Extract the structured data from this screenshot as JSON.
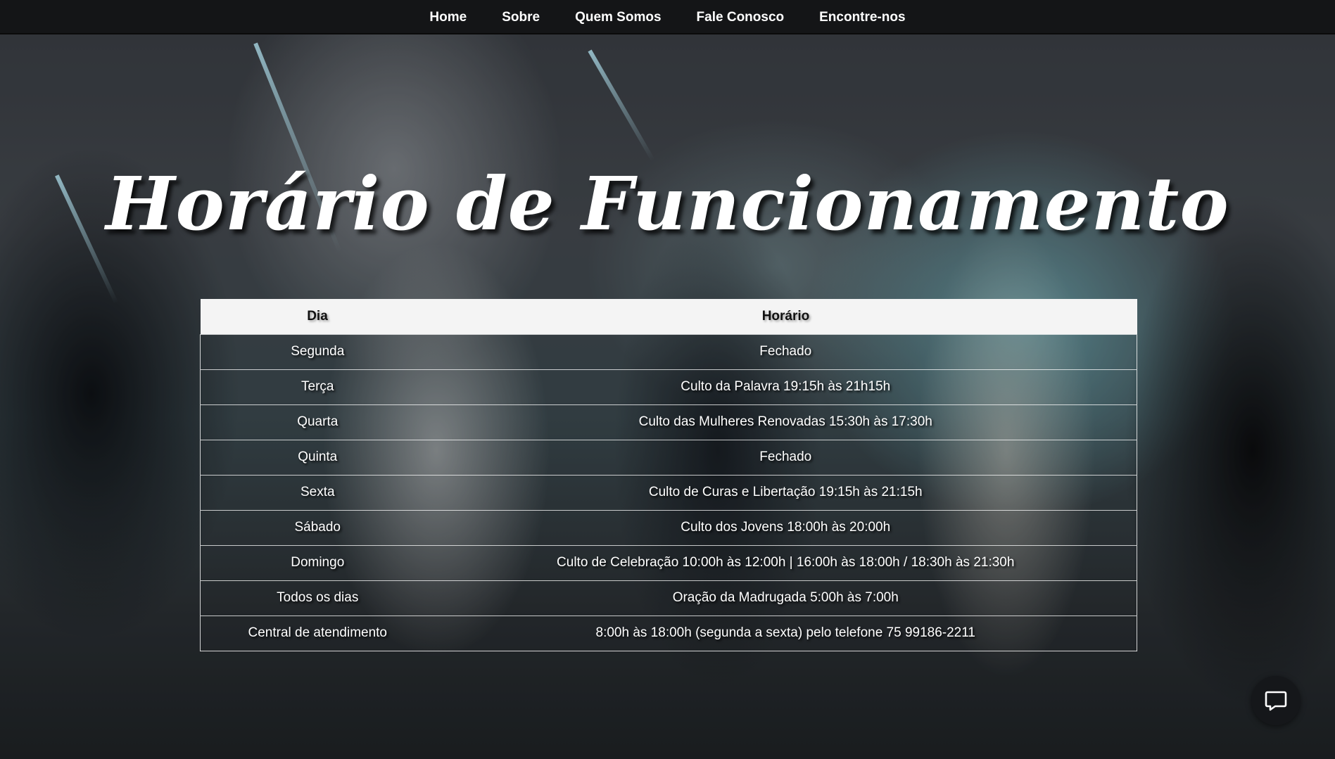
{
  "nav": {
    "items": [
      {
        "label": "Home"
      },
      {
        "label": "Sobre"
      },
      {
        "label": "Quem Somos"
      },
      {
        "label": "Fale Conosco"
      },
      {
        "label": "Encontre-nos"
      }
    ]
  },
  "hero": {
    "title": "Horário de Funcionamento"
  },
  "schedule": {
    "headers": {
      "day": "Dia",
      "time": "Horário"
    },
    "rows": [
      {
        "day": "Segunda",
        "time": "Fechado"
      },
      {
        "day": "Terça",
        "time": "Culto da Palavra 19:15h às 21h15h"
      },
      {
        "day": "Quarta",
        "time": "Culto das Mulheres Renovadas 15:30h às 17:30h"
      },
      {
        "day": "Quinta",
        "time": "Fechado"
      },
      {
        "day": "Sexta",
        "time": "Culto de Curas e Libertação 19:15h às 21:15h"
      },
      {
        "day": "Sábado",
        "time": "Culto dos Jovens 18:00h às 20:00h"
      },
      {
        "day": "Domingo",
        "time": "Culto de Celebração 10:00h às 12:00h | 16:00h às 18:00h / 18:30h às 21:30h"
      },
      {
        "day": "Todos os dias",
        "time": "Oração da Madrugada 5:00h às 7:00h"
      },
      {
        "day": "Central de atendimento",
        "time": "8:00h às 18:00h (segunda a sexta) pelo telefone 75 99186-2211"
      }
    ]
  },
  "chat": {
    "icon": "chat-bubble-icon"
  },
  "colors": {
    "navbar": "#141517",
    "header_row": "#f4f4f4",
    "text": "#ffffff"
  }
}
